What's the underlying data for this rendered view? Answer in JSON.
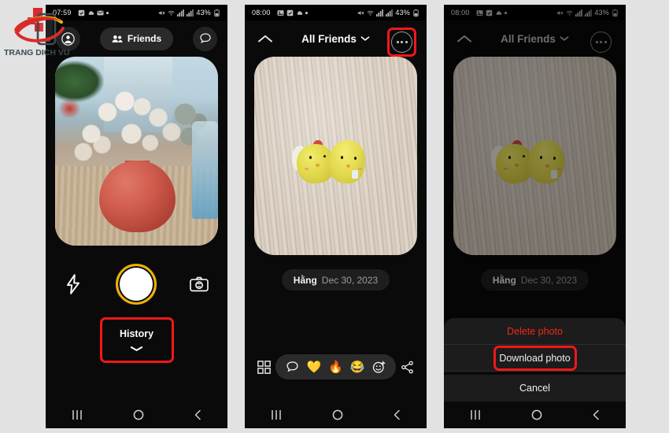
{
  "watermark": {
    "text": "TRANG DICH VU",
    "accent": "#d92b2b",
    "phone_color": "#3c4a52"
  },
  "background_color": "#e2e2e2",
  "panels": [
    {
      "id": "panel-camera",
      "status_bar": {
        "time": "07:59",
        "battery": "43%",
        "icons": [
          "checkbox-icon",
          "cloud-icon",
          "mail-icon",
          "dot-icon"
        ],
        "right_icons": [
          "mute-icon",
          "wifi-icon",
          "signal-icon",
          "signal-icon"
        ]
      },
      "header": {
        "profile_icon": "profile-avatar-icon",
        "friends_label": "Friends",
        "friends_icon": "people-icon",
        "chat_icon": "chat-bubble-icon"
      },
      "photo": {
        "alt": "red round vase with dried baby's breath on wooden table"
      },
      "camera_controls": {
        "flash_icon": "flash-icon",
        "shutter": "shutter-button",
        "flip_icon": "camera-flip-icon",
        "shutter_ring_color": "#f0b100"
      },
      "history": {
        "label": "History",
        "chevron": "chevron-down-icon",
        "highlighted": true,
        "highlight_color": "#f01818"
      },
      "navbar": {
        "recents": "recents-icon",
        "home": "home-icon",
        "back": "back-icon"
      }
    },
    {
      "id": "panel-photo-view",
      "status_bar": {
        "time": "08:00",
        "battery": "43%"
      },
      "header": {
        "chevron_up_icon": "chevron-up-icon",
        "title": "All Friends",
        "title_chevron": "chevron-down-icon",
        "more_icon": "more-options-icon",
        "more_highlighted": true,
        "highlight_color": "#f01818"
      },
      "photo": {
        "alt": "two yellow chick figurines on light wood"
      },
      "caption": {
        "name": "Hằng",
        "date": "Dec 30, 2023"
      },
      "actions": {
        "grid_icon": "grid-icon",
        "reactions": [
          "chat-bubble-icon",
          "yellow-heart-emoji",
          "fire-emoji",
          "laughing-emoji",
          "add-reaction-icon"
        ],
        "reaction_glyphs": [
          "💬",
          "💛",
          "🔥",
          "😂",
          "☺"
        ],
        "share_icon": "share-icon"
      },
      "navbar": {
        "recents": "recents-icon",
        "home": "home-icon",
        "back": "back-icon"
      }
    },
    {
      "id": "panel-action-sheet",
      "status_bar": {
        "time": "08:00",
        "battery": "43%"
      },
      "header": {
        "chevron_up_icon": "chevron-up-icon",
        "title": "All Friends",
        "title_chevron": "chevron-down-icon",
        "more_icon": "more-options-icon"
      },
      "photo": {
        "alt": "two yellow chick figurines on light wood (dimmed)"
      },
      "caption": {
        "name": "Hằng",
        "date": "Dec 30, 2023"
      },
      "sheet": {
        "items": [
          {
            "label": "Delete photo",
            "style": "danger",
            "highlighted": false
          },
          {
            "label": "Download photo",
            "style": "normal",
            "highlighted": true
          },
          {
            "label": "Cancel",
            "style": "normal",
            "highlighted": false
          }
        ],
        "highlight_color": "#f01818"
      },
      "navbar": {
        "recents": "recents-icon",
        "home": "home-icon",
        "back": "back-icon"
      }
    }
  ]
}
